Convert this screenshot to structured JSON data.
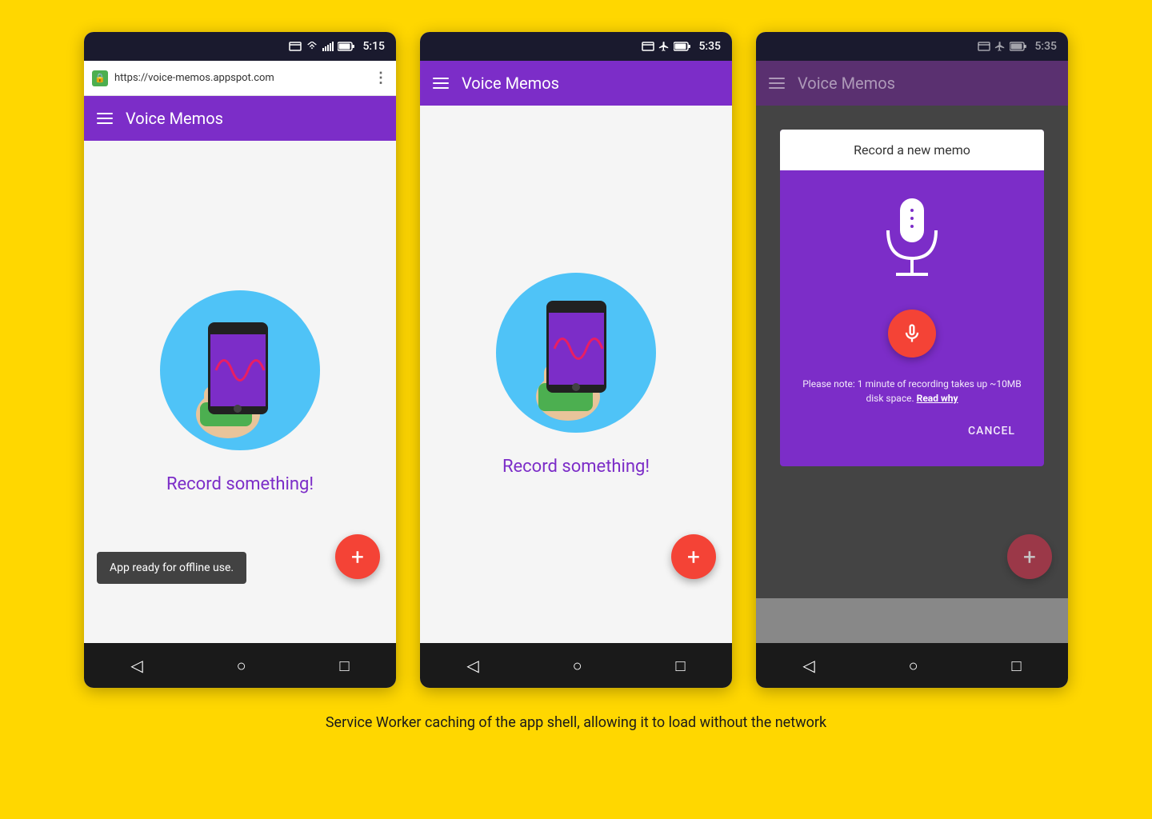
{
  "background_color": "#FFD700",
  "caption": "Service Worker caching of the app shell, allowing it to load without the network",
  "phone1": {
    "status_bar": {
      "time": "5:15",
      "has_wifi": true,
      "has_signal": true,
      "has_battery": true
    },
    "url_bar": {
      "url": "https://voice-memos.appspot.com",
      "secure": true
    },
    "app_bar": {
      "title": "Voice Memos"
    },
    "body": {
      "record_text": "Record something!"
    },
    "fab_label": "+",
    "snackbar_text": "App ready for offline use.",
    "nav_back": "◁",
    "nav_home": "○",
    "nav_recent": "□"
  },
  "phone2": {
    "status_bar": {
      "time": "5:35",
      "has_airplane": true,
      "has_battery": true
    },
    "app_bar": {
      "title": "Voice Memos"
    },
    "body": {
      "record_text": "Record something!"
    },
    "fab_label": "+",
    "nav_back": "◁",
    "nav_home": "○",
    "nav_recent": "□"
  },
  "phone3": {
    "status_bar": {
      "time": "5:35",
      "has_airplane": true,
      "has_battery": true
    },
    "app_bar": {
      "title": "Voice Memos"
    },
    "dialog": {
      "title": "Record a new memo",
      "note": "Please note: 1 minute of recording takes up ~10MB disk space.",
      "read_why": "Read why",
      "cancel": "CANCEL"
    },
    "fab_label": "+",
    "nav_back": "◁",
    "nav_home": "○",
    "nav_recent": "□"
  }
}
